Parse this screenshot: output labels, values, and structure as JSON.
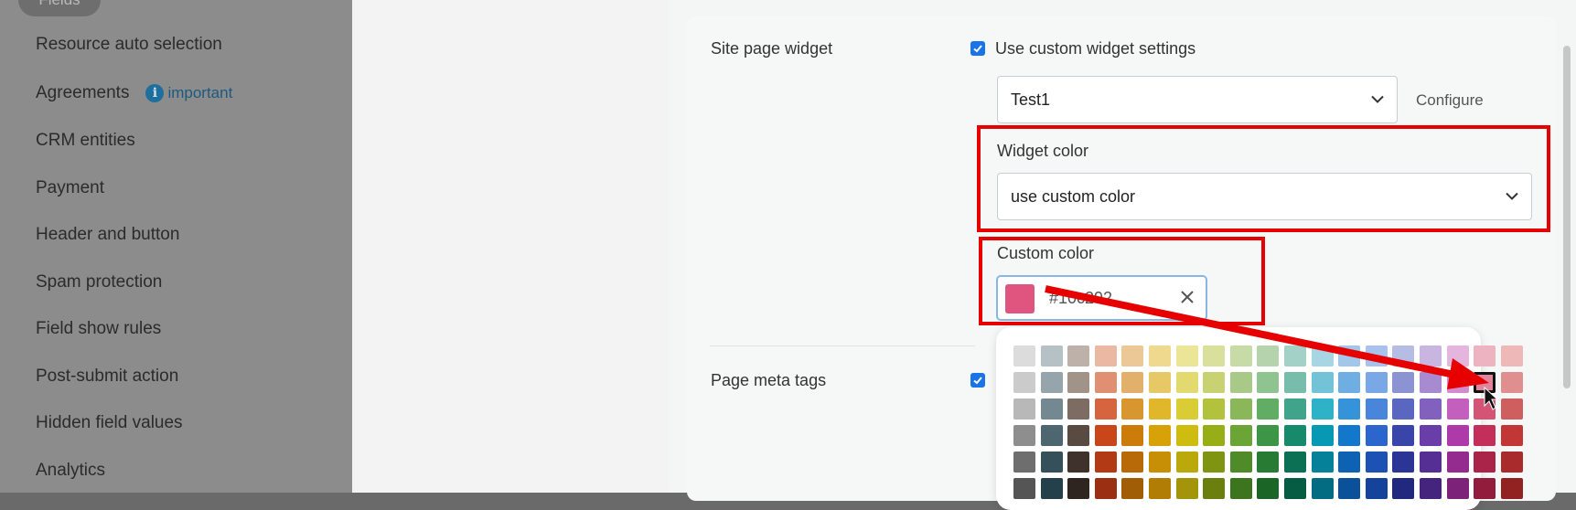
{
  "sidebar": {
    "top_pill": "Fields",
    "items": [
      {
        "label": "Resource auto selection"
      },
      {
        "label": "Agreements",
        "badge": "important"
      },
      {
        "label": "CRM entities"
      },
      {
        "label": "Payment"
      },
      {
        "label": "Header and button"
      },
      {
        "label": "Spam protection"
      },
      {
        "label": "Field show rules"
      },
      {
        "label": "Post-submit action"
      },
      {
        "label": "Hidden field values"
      },
      {
        "label": "Analytics"
      }
    ]
  },
  "form": {
    "site_page_widget_label": "Site page widget",
    "use_custom_widget_label": "Use custom widget settings",
    "use_custom_widget_checked": true,
    "widget_select_value": "Test1",
    "configure_link": "Configure",
    "widget_color_label": "Widget color",
    "widget_color_value": "use custom color",
    "custom_color_label": "Custom color",
    "custom_color_value": "#10c292",
    "page_meta_tags_label": "Page meta tags",
    "page_meta_tags_checked": true
  },
  "icons": {
    "chevron": "chevron-down-icon",
    "clear": "close-icon",
    "info": "info-icon",
    "checkbox": "checkmark-icon"
  },
  "colors": {
    "swatch": "#e05580",
    "accent_blue": "#1b73e8",
    "highlight_red": "#e60000"
  },
  "palette": {
    "rows": [
      [
        "#dcdcdc",
        "#b6c1c5",
        "#bdb1aa",
        "#eab8a3",
        "#ecc897",
        "#efd98f",
        "#ebe597",
        "#d9e09b",
        "#c7dba7",
        "#b5d4ad",
        "#a3d0c7",
        "#a8d5e3",
        "#a3c7ea",
        "#a8c2ee",
        "#b6bde4",
        "#c8b6e0",
        "#e4b6dd",
        "#eeb3c0",
        "#efb8b8"
      ],
      [
        "#cbcbcb",
        "#95a5ab",
        "#a29389",
        "#e08f73",
        "#e2b06b",
        "#e7c866",
        "#e2da6e",
        "#c8d273",
        "#a9c988",
        "#8fc38f",
        "#78bcab",
        "#72c2d8",
        "#6eaee2",
        "#7aa7e6",
        "#8b93d2",
        "#a88ad0",
        "#d58bcf",
        "#e3849d",
        "#e08f8f"
      ],
      [
        "#b8b8b8",
        "#738890",
        "#7d6c62",
        "#d6643e",
        "#d8962f",
        "#e0b62b",
        "#d9cc35",
        "#b2c23c",
        "#89b75a",
        "#61ad63",
        "#3fa48a",
        "#2db2c8",
        "#3493d9",
        "#4a85dc",
        "#5a67c0",
        "#8261be",
        "#c35fbd",
        "#d45476",
        "#cf5f5f"
      ],
      [
        "#8e8e8e",
        "#4e6670",
        "#594a42",
        "#c9451a",
        "#cc7c0b",
        "#d7a208",
        "#cebd10",
        "#98ae16",
        "#6aa536",
        "#3d9645",
        "#178a6b",
        "#0799b4",
        "#1378cc",
        "#2a66ce",
        "#3a45aa",
        "#6a3ea9",
        "#ae3aa9",
        "#c42e5a",
        "#c33636"
      ],
      [
        "#6e6e6e",
        "#36505b",
        "#3f322c",
        "#b23a15",
        "#b96a08",
        "#c68f06",
        "#bba90c",
        "#7f9511",
        "#4f8b28",
        "#287b33",
        "#0b7054",
        "#05819a",
        "#0d62b3",
        "#1d52b5",
        "#2b3595",
        "#552f93",
        "#942c90",
        "#aa2449",
        "#a92b2b"
      ],
      [
        "#555555",
        "#24404b",
        "#2e2420",
        "#9a3011",
        "#a15c06",
        "#b17d04",
        "#a39409",
        "#6a7f0d",
        "#3d741e",
        "#1b6627",
        "#065c43",
        "#036b82",
        "#0a5199",
        "#15439b",
        "#21297f",
        "#45247e",
        "#7c2279",
        "#921c3c",
        "#922121"
      ]
    ],
    "selected": {
      "row": 1,
      "col": 17
    }
  }
}
